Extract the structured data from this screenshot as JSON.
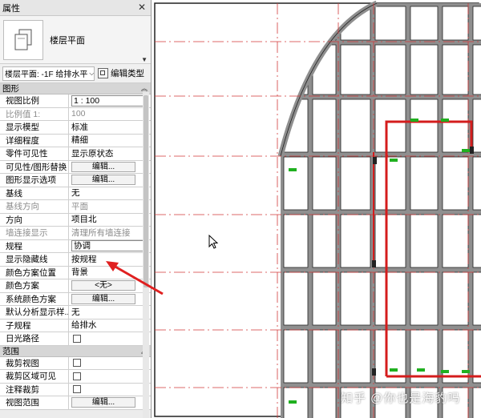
{
  "panel": {
    "title": "属性",
    "close_glyph": "✕",
    "type_name": "楼层平面",
    "filter_value": "楼层平面: -1F 给排水平",
    "edit_type_label": "编辑类型"
  },
  "sections": {
    "graphics": "图形",
    "extents": "范围"
  },
  "properties": [
    {
      "label": "视图比例",
      "value": "1 : 100",
      "kind": "boxed-text",
      "disabled": false
    },
    {
      "label": "比例值 1:",
      "value": "100",
      "kind": "text",
      "disabled": true
    },
    {
      "label": "显示模型",
      "value": "标准",
      "kind": "text",
      "disabled": false
    },
    {
      "label": "详细程度",
      "value": "精细",
      "kind": "text",
      "disabled": false
    },
    {
      "label": "零件可见性",
      "value": "显示原状态",
      "kind": "text",
      "disabled": false
    },
    {
      "label": "可见性/图形替换",
      "value": "编辑...",
      "kind": "button",
      "disabled": false
    },
    {
      "label": "图形显示选项",
      "value": "编辑...",
      "kind": "button",
      "disabled": false
    },
    {
      "label": "基线",
      "value": "无",
      "kind": "text",
      "disabled": false
    },
    {
      "label": "基线方向",
      "value": "平面",
      "kind": "text",
      "disabled": true
    },
    {
      "label": "方向",
      "value": "项目北",
      "kind": "text",
      "disabled": false
    },
    {
      "label": "墙连接显示",
      "value": "清理所有墙连接",
      "kind": "text",
      "disabled": true
    },
    {
      "label": "规程",
      "value": "协调",
      "kind": "boxed-text",
      "disabled": false
    },
    {
      "label": "显示隐藏线",
      "value": "按规程",
      "kind": "text",
      "disabled": false
    },
    {
      "label": "颜色方案位置",
      "value": "背景",
      "kind": "text",
      "disabled": false
    },
    {
      "label": "颜色方案",
      "value": "<无>",
      "kind": "button",
      "disabled": false
    },
    {
      "label": "系统颜色方案",
      "value": "编辑...",
      "kind": "button",
      "disabled": false
    },
    {
      "label": "默认分析显示样...",
      "value": "无",
      "kind": "text",
      "disabled": false
    },
    {
      "label": "子规程",
      "value": "给排水",
      "kind": "text",
      "disabled": false
    },
    {
      "label": "日光路径",
      "value": "",
      "kind": "checkbox",
      "disabled": false
    }
  ],
  "extent_properties": [
    {
      "label": "裁剪视图",
      "value": "",
      "kind": "checkbox",
      "disabled": false
    },
    {
      "label": "裁剪区域可见",
      "value": "",
      "kind": "checkbox",
      "disabled": false
    },
    {
      "label": "注释裁剪",
      "value": "",
      "kind": "checkbox",
      "disabled": false
    },
    {
      "label": "视图范围",
      "value": "编辑...",
      "kind": "button",
      "disabled": false
    }
  ],
  "watermark": "知乎 @你也是海豹吗",
  "colors": {
    "wall_fill": "#8f8f8f",
    "pipe_red": "#d41c1c",
    "grid_red": "#d23a3a",
    "annotation_arrow": "#e02020",
    "tag_green": "#20b020"
  }
}
